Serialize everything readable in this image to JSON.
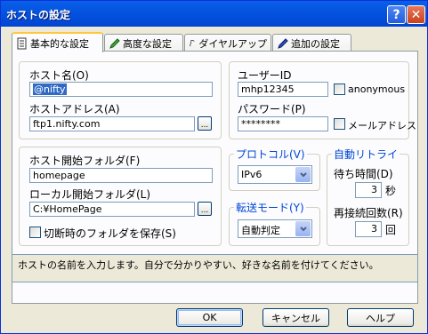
{
  "window": {
    "title": "ホストの設定",
    "help_glyph": "?",
    "close_glyph": "✕"
  },
  "tabs": [
    {
      "label": "基本的な設定",
      "icon": "notebook-icon"
    },
    {
      "label": "高度な設定",
      "icon": "pencil-green-icon"
    },
    {
      "label": "ダイヤルアップ",
      "icon": "phone-cord-icon"
    },
    {
      "label": "追加の設定",
      "icon": "pen-blue-icon"
    }
  ],
  "host": {
    "name_label": "ホスト名(O)",
    "name_value": "@nifty",
    "address_label": "ホストアドレス(A)",
    "address_value": "ftp1.nifty.com",
    "browse_label": "..."
  },
  "user": {
    "id_label": "ユーザーID",
    "id_value": "mhp12345",
    "anonymous_label": "anonymous",
    "password_label": "パスワード(P)",
    "password_value": "********",
    "mail_address_label": "メールアドレス"
  },
  "folders": {
    "host_start_label": "ホスト開始フォルダ(F)",
    "host_start_value": "homepage",
    "local_start_label": "ローカル開始フォルダ(L)",
    "local_start_value": "C:¥HomePage",
    "browse_label": "...",
    "save_on_disconnect_label": "切断時のフォルダを保存(S)"
  },
  "protocol": {
    "label": "プロトコル(V)",
    "value": "IPv6"
  },
  "transfer": {
    "label": "転送モード(Y)",
    "value": "自動判定"
  },
  "retry": {
    "label": "自動リトライ",
    "wait_label": "待ち時間(D)",
    "wait_value": "3",
    "wait_unit": "秒",
    "count_label": "再接続回数(R)",
    "count_value": "3",
    "count_unit": "回"
  },
  "status_text": "ホストの名前を入力します。自分で分かりやすい、好きな名前を付けてください。",
  "buttons": {
    "ok": "OK",
    "cancel": "キャンセル",
    "help": "ヘルプ"
  },
  "colors": {
    "titlebar": "#0a5fe8",
    "group_label": "#0046d5",
    "tab_highlight": "#ffc83c",
    "selection": "#316ac5"
  }
}
